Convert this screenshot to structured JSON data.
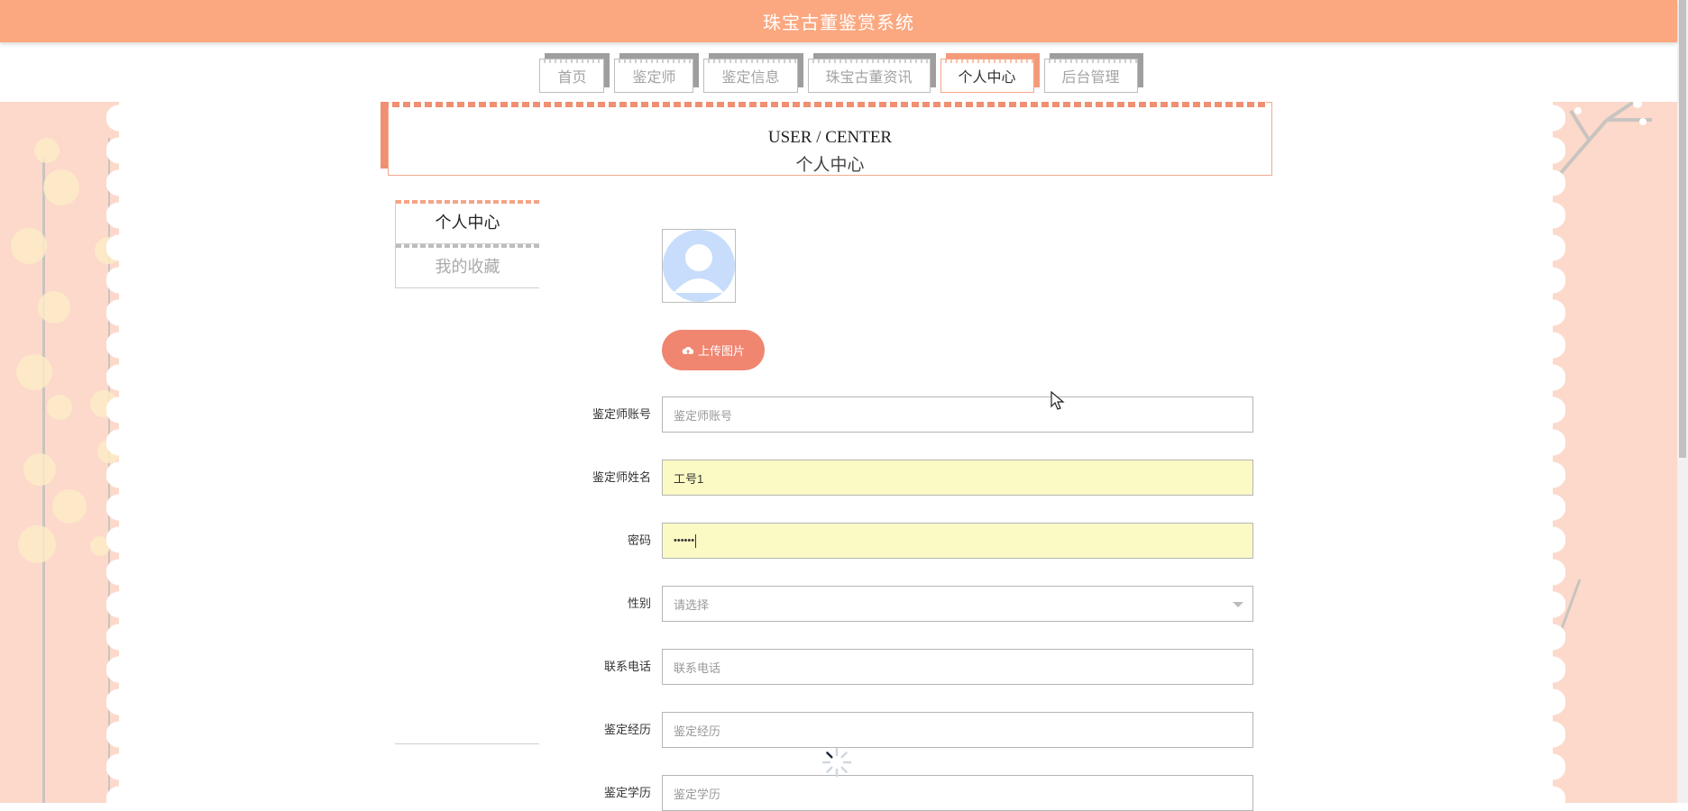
{
  "header": {
    "title": "珠宝古董鉴赏系统"
  },
  "nav": {
    "tabs": [
      {
        "label": "首页",
        "active": false
      },
      {
        "label": "鉴定师",
        "active": false
      },
      {
        "label": "鉴定信息",
        "active": false
      },
      {
        "label": "珠宝古董资讯",
        "active": false
      },
      {
        "label": "个人中心",
        "active": true
      },
      {
        "label": "后台管理",
        "active": false
      }
    ]
  },
  "banner": {
    "en": "USER / CENTER",
    "cn": "个人中心"
  },
  "menu": {
    "items": [
      {
        "label": "个人中心",
        "active": true
      },
      {
        "label": "我的收藏",
        "active": false
      }
    ]
  },
  "upload": {
    "label": "上传图片",
    "icon": "cloud-upload-icon"
  },
  "form": {
    "account": {
      "label": "鉴定师账号",
      "placeholder": "鉴定师账号",
      "value": ""
    },
    "name": {
      "label": "鉴定师姓名",
      "placeholder": "",
      "value": "工号1"
    },
    "password": {
      "label": "密码",
      "value": "••••••"
    },
    "gender": {
      "label": "性别",
      "placeholder": "请选择"
    },
    "phone": {
      "label": "联系电话",
      "placeholder": "联系电话"
    },
    "experience": {
      "label": "鉴定经历",
      "placeholder": "鉴定经历"
    },
    "education": {
      "label": "鉴定学历",
      "placeholder": "鉴定学历"
    }
  },
  "colors": {
    "header": "#fba880",
    "accent": "#f08570",
    "autofill": "#fbfac4",
    "side": "#fcd9cb"
  }
}
